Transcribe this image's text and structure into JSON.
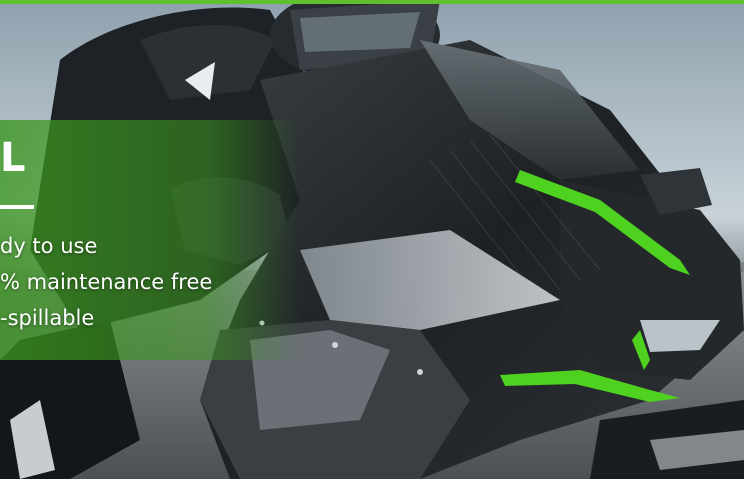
{
  "hero": {
    "heading_fragment": "L",
    "features": [
      "dy to use",
      "% maintenance free",
      "-spillable"
    ]
  },
  "colors": {
    "accent_green": "#5fbf2f",
    "overlay_green": "#3a961e",
    "text": "#ffffff"
  }
}
